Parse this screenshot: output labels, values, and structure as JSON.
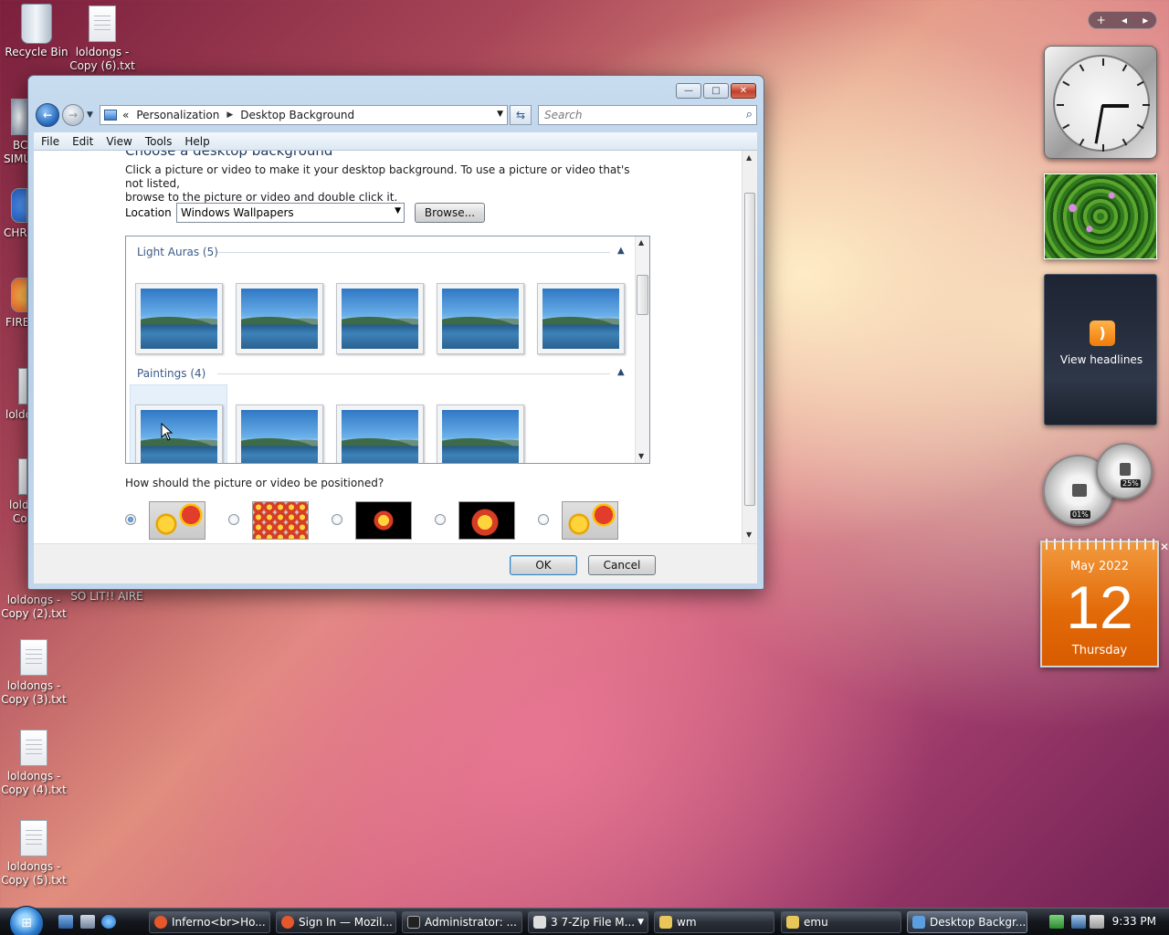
{
  "desktop": {
    "recycle_bin": "Recycle Bin",
    "icons_right": [
      {
        "line1": "loldongs -",
        "line2": "Copy (6).txt"
      }
    ],
    "icons_left": [
      {
        "line1": "loldongs -",
        "line2": "Copy (2).txt"
      },
      {
        "line1": "loldongs -",
        "line2": "Copy (3).txt"
      },
      {
        "line1": "loldongs -",
        "line2": "Copy (4).txt"
      },
      {
        "line1": "loldongs -",
        "line2": "Copy (5).txt"
      }
    ],
    "partial_labels": [
      "BC",
      "SIMU",
      "CHR",
      "FIRE",
      "loldo",
      "lold",
      "Co"
    ],
    "so_lit_label": "SO LIT!! AIRE"
  },
  "window": {
    "caption_buttons": {
      "minimize": "—",
      "maximize": "□",
      "close": "✕"
    },
    "breadcrumb": {
      "prefix": "«",
      "item1": "Personalization",
      "item2": "Desktop Background"
    },
    "search_placeholder": "Search",
    "menu": [
      "File",
      "Edit",
      "View",
      "Tools",
      "Help"
    ],
    "heading_cut": "Choose a desktop background",
    "intro_line1": "Click a picture or video to make it your desktop background. To use a picture or video that's not listed,",
    "intro_line2": "browse to the picture or video and double click it.",
    "location_label": "Location",
    "location_value": "Windows Wallpapers",
    "browse_label": "Browse...",
    "groups": [
      {
        "name": "Light Auras (5)",
        "count": 5
      },
      {
        "name": "Paintings (4)",
        "count": 4
      }
    ],
    "position_question": "How should the picture or video be positioned?",
    "position_options": [
      "fill",
      "tile",
      "center",
      "fit",
      "stretch"
    ],
    "selected_position": 0,
    "ok_label": "OK",
    "cancel_label": "Cancel"
  },
  "gadgets": {
    "bar": {
      "add": "+",
      "prev": "◂",
      "next": "▸"
    },
    "clock": {
      "hour_angle": 90,
      "minute_angle": 190
    },
    "feed_label": "View headlines",
    "meters": {
      "cpu": "01%",
      "mem": "25%"
    },
    "calendar": {
      "month": "May 2022",
      "day": "12",
      "weekday": "Thursday",
      "close": "✕"
    }
  },
  "taskbar": {
    "start_label": "⊞",
    "buttons": [
      {
        "label": "Inferno<br>Ho...",
        "icon_color": "#e6572a"
      },
      {
        "label": "Sign In — Mozil...",
        "icon_color": "#e6572a"
      },
      {
        "label": "Administrator: ...",
        "icon_color": "#222222"
      },
      {
        "label": "3 7-Zip File M...",
        "icon_color": "#dddddd"
      },
      {
        "label": "wm",
        "icon_color": "#e8c65a"
      },
      {
        "label": "emu",
        "icon_color": "#e8c65a"
      },
      {
        "label": "Desktop Backgr...",
        "icon_color": "#5c9fe0"
      }
    ],
    "time": "9:33 PM"
  }
}
